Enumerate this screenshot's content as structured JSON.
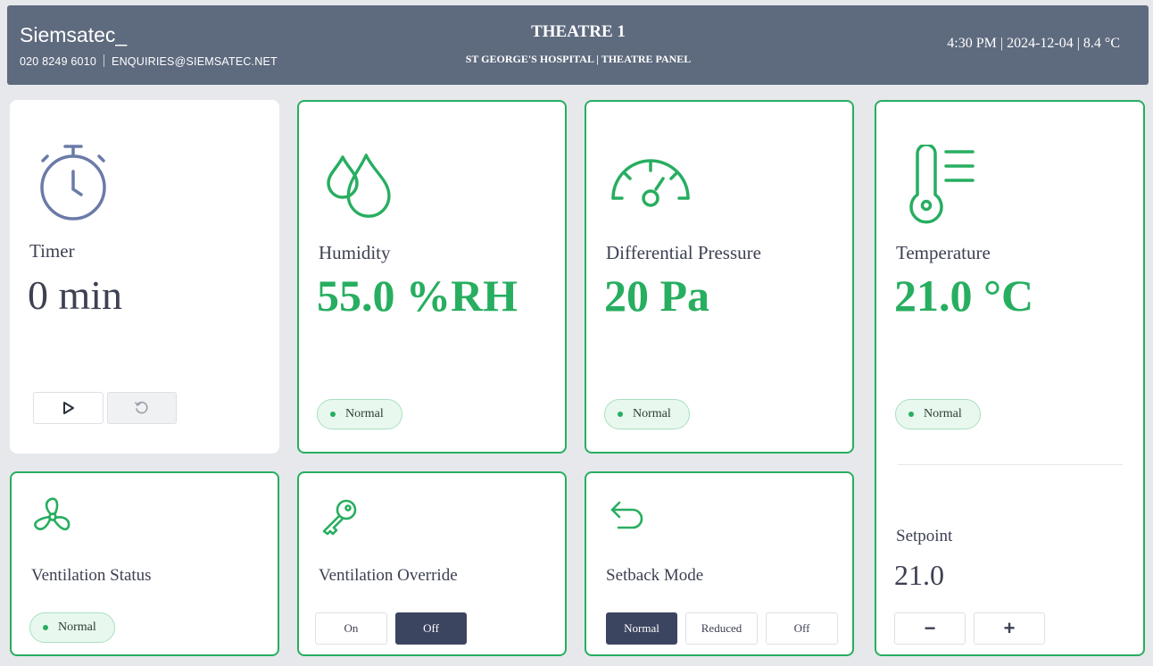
{
  "header": {
    "brand": "Siemsatec_",
    "phone": "020 8249 6010",
    "email": "ENQUIRIES@SIEMSATEC.NET",
    "title": "THEATRE 1",
    "subtitle": "ST GEORGE'S HOSPITAL | THEATRE PANEL",
    "status": "4:30 PM | 2024-12-04 | 8.4 °C"
  },
  "timer": {
    "label": "Timer",
    "value": "0 min",
    "icon": "stopwatch-icon"
  },
  "humidity": {
    "label": "Humidity",
    "value": "55.0 %RH",
    "status": "Normal",
    "icon": "droplets-icon"
  },
  "pressure": {
    "label": "Differential Pressure",
    "value": "20 Pa",
    "status": "Normal",
    "icon": "gauge-icon"
  },
  "temperature": {
    "label": "Temperature",
    "value": "21.0 °C",
    "status": "Normal",
    "icon": "thermometer-icon",
    "setpoint_label": "Setpoint",
    "setpoint_value": "21.0",
    "minus_label": "−",
    "plus_label": "+"
  },
  "ventilation_status": {
    "label": "Ventilation Status",
    "status": "Normal",
    "icon": "fan-icon"
  },
  "ventilation_override": {
    "label": "Ventilation Override",
    "icon": "key-icon",
    "options": [
      "On",
      "Off"
    ],
    "selected": "Off"
  },
  "setback_mode": {
    "label": "Setback Mode",
    "icon": "undo-arrow-icon",
    "options": [
      "Normal",
      "Reduced",
      "Off"
    ],
    "selected": "Normal"
  },
  "colors": {
    "accent": "#27ae60",
    "header": "#5e6a7e",
    "active_button": "#3c4560",
    "timer_icon": "#6b7ba8"
  }
}
